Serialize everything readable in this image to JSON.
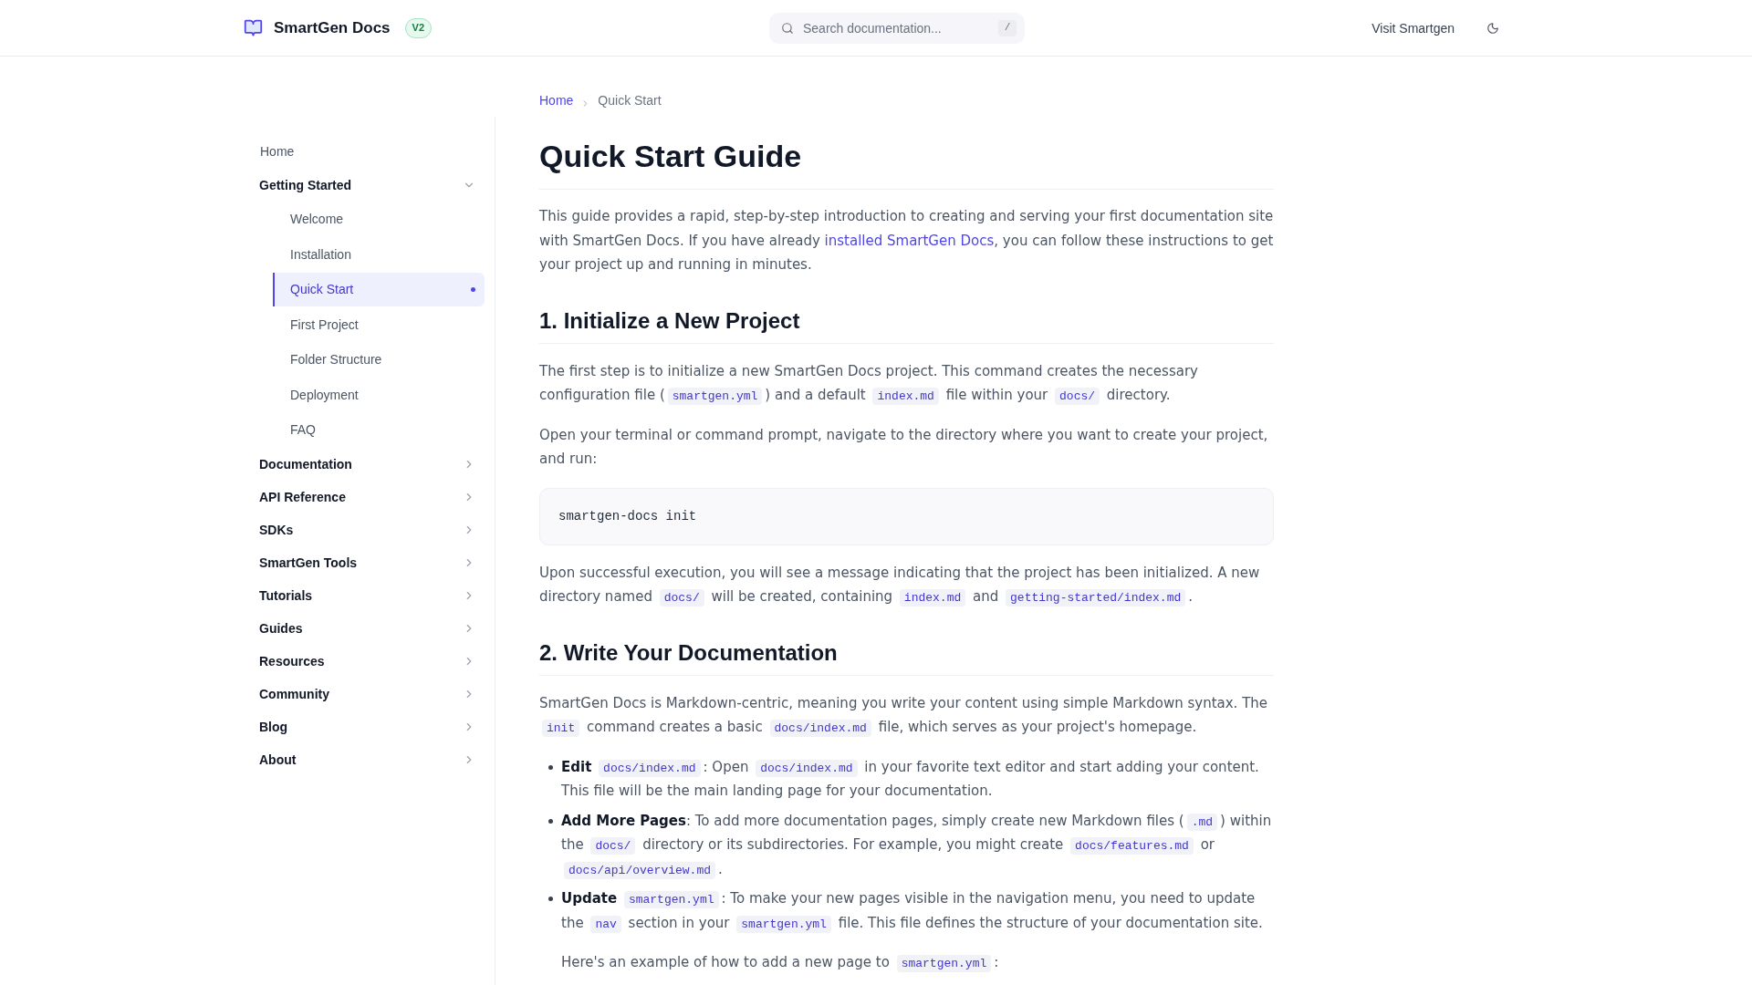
{
  "header": {
    "brand": "SmartGen Docs",
    "badge": "V2",
    "search": {
      "placeholder": "Search documentation...",
      "shortcut": "/"
    },
    "nav_links": [
      {
        "label": "Visit Smartgen"
      }
    ]
  },
  "sidebar": {
    "items": [
      {
        "kind": "link",
        "label": "Home",
        "selected": false
      },
      {
        "kind": "group",
        "label": "Getting Started",
        "expanded": true,
        "children": [
          {
            "label": "Welcome",
            "selected": false
          },
          {
            "label": "Installation",
            "selected": false
          },
          {
            "label": "Quick Start",
            "selected": true
          },
          {
            "label": "First Project",
            "selected": false
          },
          {
            "label": "Folder Structure",
            "selected": false
          },
          {
            "label": "Deployment",
            "selected": false
          },
          {
            "label": "FAQ",
            "selected": false
          }
        ]
      },
      {
        "kind": "group",
        "label": "Documentation",
        "expanded": false
      },
      {
        "kind": "group",
        "label": "API Reference",
        "expanded": false
      },
      {
        "kind": "group",
        "label": "SDKs",
        "expanded": false
      },
      {
        "kind": "group",
        "label": "SmartGen Tools",
        "expanded": false
      },
      {
        "kind": "group",
        "label": "Tutorials",
        "expanded": false
      },
      {
        "kind": "group",
        "label": "Guides",
        "expanded": false
      },
      {
        "kind": "group",
        "label": "Resources",
        "expanded": false
      },
      {
        "kind": "group",
        "label": "Community",
        "expanded": false
      },
      {
        "kind": "group",
        "label": "Blog",
        "expanded": false
      },
      {
        "kind": "group",
        "label": "About",
        "expanded": false
      }
    ]
  },
  "breadcrumb": [
    {
      "kind": "link",
      "label": "Home"
    },
    {
      "kind": "current",
      "label": "Quick Start"
    }
  ],
  "article": {
    "title": "Quick Start Guide",
    "blocks": [
      {
        "kind": "paragraph",
        "segments": [
          {
            "kind": "text",
            "text": "This guide provides a rapid, step-by-step introduction to creating and serving your first documentation site with SmartGen Docs. If you have already "
          },
          {
            "kind": "link",
            "text": "installed SmartGen Docs"
          },
          {
            "kind": "text",
            "text": ", you can follow these instructions to get your project up and running in minutes."
          }
        ]
      },
      {
        "kind": "heading",
        "text": "1. Initialize a New Project"
      },
      {
        "kind": "paragraph",
        "segments": [
          {
            "kind": "text",
            "text": "The first step is to initialize a new SmartGen Docs project. This command creates the necessary configuration file ("
          },
          {
            "kind": "code",
            "text": "smartgen.yml"
          },
          {
            "kind": "text",
            "text": ") and a default "
          },
          {
            "kind": "code",
            "text": "index.md"
          },
          {
            "kind": "text",
            "text": " file within your "
          },
          {
            "kind": "code",
            "text": "docs/"
          },
          {
            "kind": "text",
            "text": " directory."
          }
        ]
      },
      {
        "kind": "paragraph",
        "segments": [
          {
            "kind": "text",
            "text": "Open your terminal or command prompt, navigate to the directory where you want to create your project, and run:"
          }
        ]
      },
      {
        "kind": "code_block",
        "text": "smartgen-docs init"
      },
      {
        "kind": "paragraph",
        "segments": [
          {
            "kind": "text",
            "text": "Upon successful execution, you will see a message indicating that the project has been initialized. A new directory named "
          },
          {
            "kind": "code",
            "text": "docs/"
          },
          {
            "kind": "text",
            "text": " will be created, containing "
          },
          {
            "kind": "code",
            "text": "index.md"
          },
          {
            "kind": "text",
            "text": " and "
          },
          {
            "kind": "code",
            "text": "getting-started/index.md"
          },
          {
            "kind": "text",
            "text": "."
          }
        ]
      },
      {
        "kind": "heading",
        "text": "2. Write Your Documentation"
      },
      {
        "kind": "paragraph",
        "segments": [
          {
            "kind": "text",
            "text": "SmartGen Docs is Markdown-centric, meaning you write your content using simple Markdown syntax. The "
          },
          {
            "kind": "code",
            "text": "init"
          },
          {
            "kind": "text",
            "text": " command creates a basic "
          },
          {
            "kind": "code",
            "text": "docs/index.md"
          },
          {
            "kind": "text",
            "text": " file, which serves as your project's homepage."
          }
        ]
      },
      {
        "kind": "list",
        "items": [
          {
            "paragraphs": [
              [
                {
                  "kind": "text",
                  "text": "**Edit** "
                },
                {
                  "kind": "code",
                  "text": "docs/index.md"
                },
                {
                  "kind": "text",
                  "text": ": Open "
                },
                {
                  "kind": "code",
                  "text": "docs/index.md"
                },
                {
                  "kind": "text",
                  "text": " in your favorite text editor and start adding your content. This file will be the main landing page for your documentation."
                }
              ]
            ]
          },
          {
            "paragraphs": [
              [
                {
                  "kind": "text",
                  "text": "**Add More Pages**: To add more documentation pages, simply create new Markdown files ("
                },
                {
                  "kind": "code",
                  "text": ".md"
                },
                {
                  "kind": "text",
                  "text": ") within the "
                },
                {
                  "kind": "code",
                  "text": "docs/"
                },
                {
                  "kind": "text",
                  "text": " directory or its subdirectories. For example, you might create "
                },
                {
                  "kind": "code",
                  "text": "docs/features.md"
                },
                {
                  "kind": "text",
                  "text": " or "
                },
                {
                  "kind": "code",
                  "text": "docs/api/overview.md"
                },
                {
                  "kind": "text",
                  "text": "."
                }
              ]
            ]
          },
          {
            "paragraphs": [
              [
                {
                  "kind": "text",
                  "text": "**Update** "
                },
                {
                  "kind": "code",
                  "text": "smartgen.yml"
                },
                {
                  "kind": "text",
                  "text": ": To make your new pages visible in the navigation menu, you need to update the "
                },
                {
                  "kind": "code",
                  "text": "nav"
                },
                {
                  "kind": "text",
                  "text": " section in your "
                },
                {
                  "kind": "code",
                  "text": "smartgen.yml"
                },
                {
                  "kind": "text",
                  "text": " file. This file defines the structure of your documentation site."
                }
              ],
              [
                {
                  "kind": "text",
                  "text": "Here's an example of how to add a new page to "
                },
                {
                  "kind": "code",
                  "text": "smartgen.yml"
                },
                {
                  "kind": "text",
                  "text": ":"
                }
              ]
            ]
          }
        ]
      }
    ]
  }
}
